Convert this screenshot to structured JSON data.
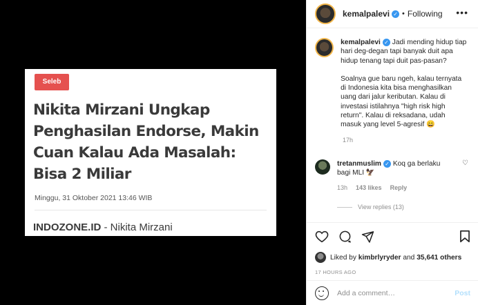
{
  "media": {
    "tag": "Seleb",
    "headline": "Nikita Mirzani Ungkap Penghasilan Endorse, Makin Cuan Kalau Ada Masalah: Bisa 2 Miliar",
    "date": "Minggu, 31 Oktober 2021 13:46 WIB",
    "source_brand": "INDOZONE.ID",
    "source_rest": " - Nikita Mirzani"
  },
  "header": {
    "username": "kemalpalevi",
    "dot": "•",
    "following": "Following",
    "more": "•••"
  },
  "caption": {
    "username": "kemalpalevi",
    "line1": "Jadi mending hidup tiap hari deg-degan tapi banyak duit apa hidup tenang tapi duit pas-pasan?",
    "body": "Soalnya gue baru ngeh, kalau ternyata di Indonesia kita bisa menghasilkan uang dari jalur keributan. Kalau di investasi istilahnya \"high risk high return\". Kalau di reksadana, udah masuk yang level 5-agresif 😄",
    "time": "17h"
  },
  "comment": {
    "username": "tretanmuslim",
    "text": "Koq ga berlaku bagi MLI 🦅",
    "time": "13h",
    "likes": "143 likes",
    "reply": "Reply",
    "view_replies": "View replies (13)"
  },
  "likes": {
    "prefix": "Liked by ",
    "user": "kimbrlyryder",
    "and": " and ",
    "count": "35,641 others"
  },
  "ago": "17 HOURS AGO",
  "add_comment": {
    "placeholder": "Add a comment…",
    "post": "Post"
  },
  "colors": {
    "tag_bg": "#e5514f",
    "verified": "#3897f0",
    "post_disabled": "#b2dffc"
  },
  "icons": [
    "heart-icon",
    "comment-icon",
    "share-icon",
    "bookmark-icon",
    "emoji-icon",
    "verified-icon"
  ]
}
